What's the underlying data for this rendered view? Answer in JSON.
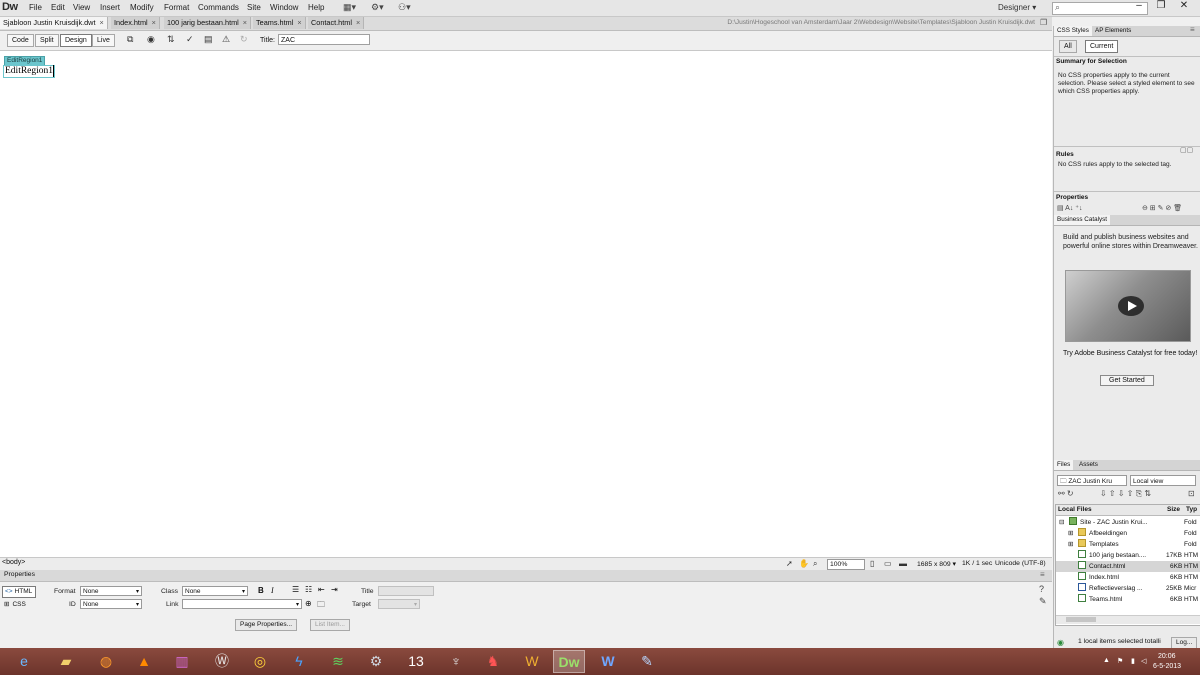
{
  "app": {
    "logo": "Dw",
    "workspace": "Designer",
    "workspace_arrow": "▾"
  },
  "menu": [
    "File",
    "Edit",
    "View",
    "Insert",
    "Modify",
    "Format",
    "Commands",
    "Site",
    "Window",
    "Help"
  ],
  "window_controls": {
    "minimize": "–",
    "maximize": "❐",
    "close": "✕"
  },
  "tabs": [
    {
      "label": "Sjabloon Justin Kruisdijk.dwt",
      "active": true
    },
    {
      "label": "Index.html"
    },
    {
      "label": "100 jarig bestaan.html"
    },
    {
      "label": "Teams.html"
    },
    {
      "label": "Contact.html"
    }
  ],
  "tab_close": "×",
  "doc_path": "D:\\Justin\\Hogeschool van Amsterdam\\Jaar 2\\Webdesign\\Website\\Templates\\Sjabloon Justin Kruisdijk.dwt",
  "doc_toolbar": {
    "code": "Code",
    "split": "Split",
    "design": "Design",
    "live": "Live",
    "title_label": "Title:",
    "title_value": "ZAC"
  },
  "design": {
    "tag": "EditRegion1",
    "content": "EditRegion1"
  },
  "status": {
    "tag": "<body>",
    "zoom": "100%",
    "window_size": "1685 x 809 ▾",
    "download": "1K / 1 sec",
    "encoding": "Unicode (UTF-8)"
  },
  "properties": {
    "title": "Properties",
    "html_mode": "HTML",
    "css_mode": "CSS",
    "format_label": "Format",
    "format_value": "None",
    "class_label": "Class",
    "class_value": "None",
    "id_label": "ID",
    "id_value": "None",
    "link_label": "Link",
    "title_label": "Title",
    "target_label": "Target",
    "bold": "B",
    "italic": "I",
    "page_properties": "Page Properties...",
    "list_item": "List Item..."
  },
  "css_panel": {
    "tab_styles": "CSS Styles",
    "tab_ap": "AP Elements",
    "all": "All",
    "current": "Current",
    "summary_title": "Summary for Selection",
    "summary_text": "No CSS properties apply to the current selection.  Please select a styled element to see which CSS properties apply.",
    "rules_title": "Rules",
    "rules_text": "No CSS rules apply to the selected tag.",
    "properties_title": "Properties"
  },
  "bc_panel": {
    "tab": "Business Catalyst",
    "text": "Build and publish business websites and powerful online stores within Dreamweaver.",
    "try": "Try Adobe Business Catalyst for free today!",
    "button": "Get Started"
  },
  "files_panel": {
    "tab_files": "Files",
    "tab_assets": "Assets",
    "site": "ZAC Justin Kru",
    "view": "Local view",
    "col_local": "Local Files",
    "col_size": "Size",
    "col_type": "Typ",
    "rows": [
      {
        "name": "Site - ZAC Justin Krui...",
        "size": "",
        "type": "Fold"
      },
      {
        "name": "Afbeeldingen",
        "size": "",
        "type": "Fold"
      },
      {
        "name": "Templates",
        "size": "",
        "type": "Fold"
      },
      {
        "name": "100 jarig bestaan....",
        "size": "17KB",
        "type": "HTM"
      },
      {
        "name": "Contact.html",
        "size": "6KB",
        "type": "HTM"
      },
      {
        "name": "Index.html",
        "size": "6KB",
        "type": "HTM"
      },
      {
        "name": "Reflectieverslag ...",
        "size": "25KB",
        "type": "Micr"
      },
      {
        "name": "Teams.html",
        "size": "6KB",
        "type": "HTM"
      }
    ],
    "status": "1 local items selected totalli",
    "log": "Log..."
  },
  "taskbar": {
    "time": "20:06",
    "date": "6-5-2013"
  }
}
